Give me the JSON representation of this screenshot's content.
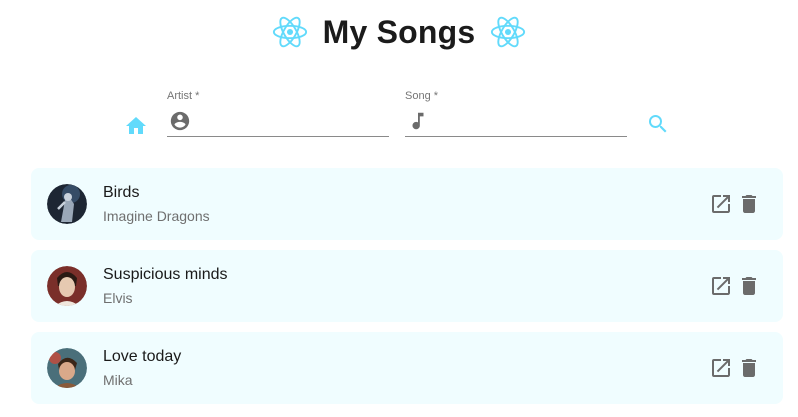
{
  "header": {
    "title": "My Songs",
    "logo_icon": "react-atom-icon",
    "accent_color": "#61dafb"
  },
  "search": {
    "home_icon": "home-icon",
    "artist_field": {
      "label": "Artist *",
      "value": "",
      "icon": "account-circle-icon"
    },
    "song_field": {
      "label": "Song *",
      "value": "",
      "icon": "music-note-icon"
    },
    "search_icon": "search-icon"
  },
  "songs": [
    {
      "title": "Birds",
      "artist": "Imagine Dragons",
      "open_icon": "open-in-new-icon",
      "delete_icon": "trash-icon"
    },
    {
      "title": "Suspicious minds",
      "artist": "Elvis",
      "open_icon": "open-in-new-icon",
      "delete_icon": "trash-icon"
    },
    {
      "title": "Love today",
      "artist": "Mika",
      "open_icon": "open-in-new-icon",
      "delete_icon": "trash-icon"
    }
  ],
  "colors": {
    "accent": "#61dafb",
    "card_background": "#f0fdff",
    "icon_gray": "#6b6b6b"
  }
}
